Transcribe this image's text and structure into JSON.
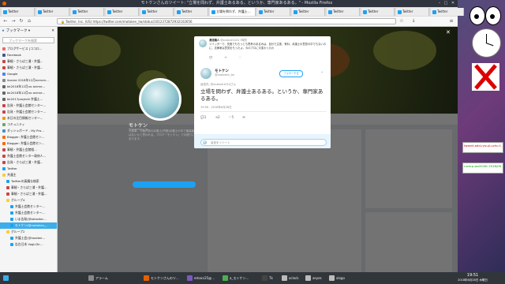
{
  "window_title": "モトケンさんのツイート: \"立場を問わず、弁護士あるある。というか、専門家あるある。\" - Mozilla Firefox",
  "tabs": [
    {
      "label": "Twitter"
    },
    {
      "label": "Twitter"
    },
    {
      "label": "Twitter"
    },
    {
      "label": "Twitter"
    },
    {
      "label": "Twitter"
    },
    {
      "label": "Twitter"
    },
    {
      "label": "立場を問わず、弁護士…"
    },
    {
      "label": "Twitter"
    },
    {
      "label": "Twitter"
    },
    {
      "label": "Twitter"
    },
    {
      "label": "Twitter"
    },
    {
      "label": "Twitter"
    },
    {
      "label": "Twitter"
    }
  ],
  "url": "Twitter, Inc. (US)  https://twitter.com/motoken_tw/status/1012372872932102656",
  "sidebar": {
    "header": "ブックマーク",
    "search_placeholder": "ブックマークを検索",
    "items": [
      {
        "label": "ブログサービス [ココロ…",
        "color": "#e66"
      },
      {
        "label": "Facebook",
        "color": "#3b5998"
      },
      {
        "label": "事細・さらば三浦・弁護…",
        "color": "#c44"
      },
      {
        "label": "事細・さらば三浦・弁護…",
        "color": "#c44"
      },
      {
        "label": "Google",
        "color": "#4285f4"
      },
      {
        "label": "itorare 2018年12月nerven…",
        "color": "#888"
      },
      {
        "label": "bk2018年12月no anime…",
        "color": "#666"
      },
      {
        "label": "bk2018年12月no anime…",
        "color": "#666"
      },
      {
        "label": "bk2017projectt 弁護士…",
        "color": "#666"
      },
      {
        "label": "告発・弁護士会館センター…",
        "color": "#c44"
      },
      {
        "label": "告発・弁護士会館センター…",
        "color": "#c44"
      },
      {
        "label": "本日の注目情報センター…",
        "color": "#e90"
      },
      {
        "label": "コミュニティ",
        "color": "#6a6"
      },
      {
        "label": "ダッシュボード - My Pro…",
        "color": "#39c"
      },
      {
        "label": "Blogger: 弁護士会館セン…",
        "color": "#f60"
      },
      {
        "label": "Blogger: 弁護士会館セン…",
        "color": "#f60"
      },
      {
        "label": "事細・弁護士会館組…",
        "color": "#c44"
      },
      {
        "label": "弁護士会館センター政府人…",
        "color": "#c44"
      },
      {
        "label": "告発・さらば三浦・弁護…",
        "color": "#c44"
      }
    ],
    "tree": [
      {
        "label": "Twitter",
        "color": "#1da1f2"
      },
      {
        "label": "共通主",
        "color": "#fc3"
      },
      {
        "label": "Twitterの真贋な検索",
        "color": "#1da1f2"
      },
      {
        "label": "事細・さらば三浦・弁護…",
        "color": "#c44"
      },
      {
        "label": "事細・さらば三浦・弁護…",
        "color": "#c44"
      },
      {
        "label": "グループ4",
        "color": "#fc3"
      },
      {
        "label": "弁護士会館センター…",
        "color": "#1da1f2"
      },
      {
        "label": "弁護士会館センター…",
        "color": "#1da1f2"
      },
      {
        "label": "いま告発(@bktwiter…",
        "color": "#1da1f2"
      },
      {
        "label": "モトケン(@motoken_…",
        "color": "#1da1f2"
      },
      {
        "label": "グループ2",
        "color": "#fc3"
      },
      {
        "label": "弁護士会(@hoaiker…",
        "color": "#1da1f2"
      },
      {
        "label": "告白日本 Vogt-Dir…",
        "color": "#1da1f2"
      }
    ],
    "selected_index": 9
  },
  "profile": {
    "name": "モトケン",
    "handle": "@motoken_tw",
    "bio": "元検事、元裁判官の弁護士(同期)弁護士の中で最高齢ではないかと思われる。ブログ「モトケン」での語りにもあります。"
  },
  "modal": {
    "reply_header_name": "漂流職人",
    "reply_header_handle": "@snabne1024",
    "reply_header_time": "7時間",
    "reply_text": "ツイッターで、充実でもちっとも思考のあるみは、自分で主張、有料、弁護士の意見の中でもないのに、法律家は意見をもったよ、今のプロに今変わったわ",
    "author_name": "モトケン",
    "author_handle": "@motoken_tw",
    "follow_label": "フォローする",
    "replying_to": "返信先: @snabne1024さん",
    "tweet_text": "立場を問わず、弁護士あるある。というか、専門家あるある。",
    "timestamp": "19:56 - 2018年6月28日",
    "reply_placeholder": "返信をツイート",
    "counts": {
      "replies": "1",
      "retweets": "2",
      "likes": "5"
    }
  },
  "taskbar": {
    "items": [
      {
        "label": "",
        "color": "#3daee9"
      },
      {
        "label": "アラーム",
        "color": "#888"
      },
      {
        "label": "モトケンさんのツ…",
        "color": "#e66000"
      },
      {
        "label": "emacs25@…",
        "color": "#7e57c2"
      },
      {
        "label": "a_モトケン…",
        "color": "#4caf50"
      },
      {
        "label": "Tk",
        "color": "#444"
      },
      {
        "label": "xclock",
        "color": "#bbb"
      },
      {
        "label": "xeyes",
        "color": "#bbb"
      },
      {
        "label": "xlogo",
        "color": "#bbb"
      }
    ],
    "time": "19:51",
    "date": "2018年6月28日 木曜日"
  },
  "widgets": {
    "sticky1": "twaret-add-ryuuji-uchu.f…",
    "sticky2": "r.smrp-wo2018r 2018/09"
  }
}
